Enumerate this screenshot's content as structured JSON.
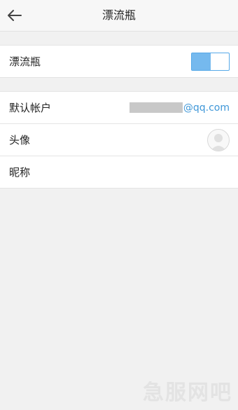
{
  "header": {
    "title": "漂流瓶",
    "back_icon": "arrow-left-icon"
  },
  "sections": {
    "toggle_row": {
      "label": "漂流瓶",
      "enabled": true,
      "accent": "#75b9ee"
    },
    "account_row": {
      "label": "默认帐户",
      "domain": "@qq.com"
    },
    "avatar_row": {
      "label": "头像",
      "icon": "user-avatar-icon"
    },
    "nickname_row": {
      "label": "昵称"
    }
  },
  "watermark": "急服网吧"
}
